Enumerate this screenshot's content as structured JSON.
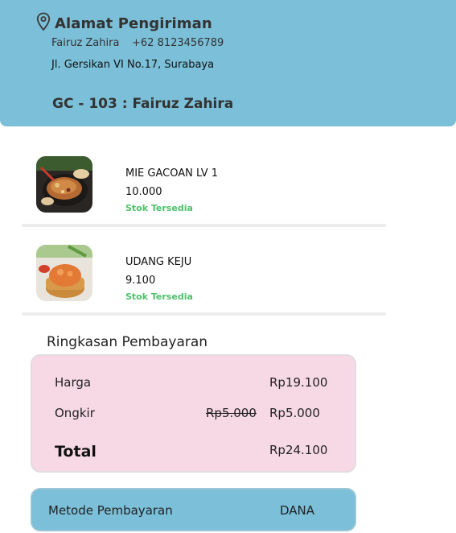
{
  "header": {
    "title": "Alamat Pengiriman",
    "name": "Fairuz Zahira",
    "phone": "+62 8123456789",
    "address": "Jl. Gersikan VI No.17, Surabaya",
    "order": "GC - 103 : Fairuz Zahira"
  },
  "items": [
    {
      "name": "MIE GACOAN LV 1",
      "price": "10.000",
      "stock": "Stok Tersedia",
      "image": "mie-gacoan-photo"
    },
    {
      "name": "UDANG KEJU",
      "price": "9.100",
      "stock": "Stok Tersedia",
      "image": "udang-keju-photo"
    }
  ],
  "summary": {
    "title": "Ringkasan Pembayaran",
    "price_label": "Harga",
    "price_value": "Rp19.100",
    "shipping_label": "Ongkir",
    "shipping_original": "Rp5.000",
    "shipping_value": "Rp5.000",
    "total_label": "Total",
    "total_value": "Rp24.100"
  },
  "payment": {
    "label": "Metode Pembayaran",
    "value": "DANA"
  },
  "colors": {
    "header_bg": "#7bbfd8",
    "summary_bg": "#f7d9e5",
    "stock_green": "#4cc26a"
  }
}
